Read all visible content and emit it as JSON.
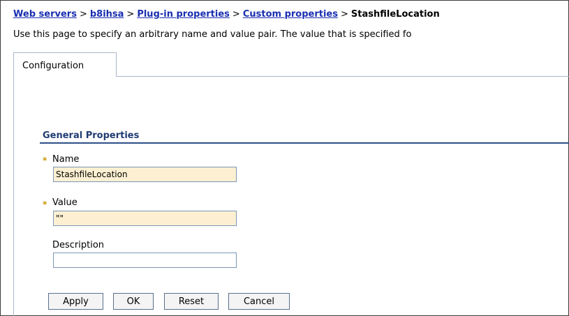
{
  "breadcrumb": {
    "items": [
      "Web servers",
      "b8ihsa",
      "Plug-in properties",
      "Custom properties"
    ],
    "separator": ">",
    "current": "StashfileLocation"
  },
  "page": {
    "description": "Use this page to specify an arbitrary name and value pair. The value that is specified fo"
  },
  "tabs": [
    {
      "label": "Configuration"
    }
  ],
  "section": {
    "title": "General Properties"
  },
  "form": {
    "required_marker": "*",
    "name_label": "Name",
    "name_value": "StashfileLocation",
    "value_label": "Value",
    "value_value": "\"\"",
    "description_label": "Description",
    "description_value": ""
  },
  "buttons": {
    "apply": "Apply",
    "ok": "OK",
    "reset": "Reset",
    "cancel": "Cancel"
  },
  "colors": {
    "link": "#1a2fb0",
    "section_title": "#1f3c72",
    "required_marker": "#c89400",
    "required_field_bg": "#fdf0d2"
  }
}
